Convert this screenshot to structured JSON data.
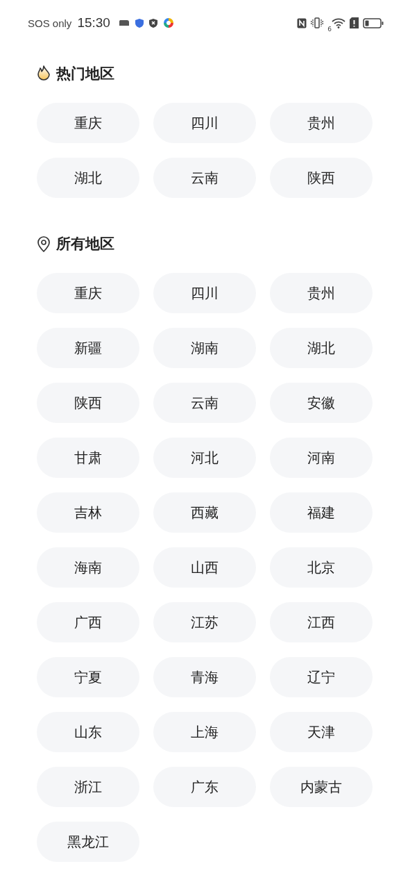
{
  "status_bar": {
    "carrier": "SOS only",
    "time": "15:30",
    "wifi_badge": "6"
  },
  "sections": [
    {
      "kind": "hot",
      "title": "热门地区",
      "regions": [
        "重庆",
        "四川",
        "贵州",
        "湖北",
        "云南",
        "陕西"
      ]
    },
    {
      "kind": "all",
      "title": "所有地区",
      "regions": [
        "重庆",
        "四川",
        "贵州",
        "新疆",
        "湖南",
        "湖北",
        "陕西",
        "云南",
        "安徽",
        "甘肃",
        "河北",
        "河南",
        "吉林",
        "西藏",
        "福建",
        "海南",
        "山西",
        "北京",
        "广西",
        "江苏",
        "江西",
        "宁夏",
        "青海",
        "辽宁",
        "山东",
        "上海",
        "天津",
        "浙江",
        "广东",
        "内蒙古",
        "黑龙江"
      ]
    }
  ]
}
